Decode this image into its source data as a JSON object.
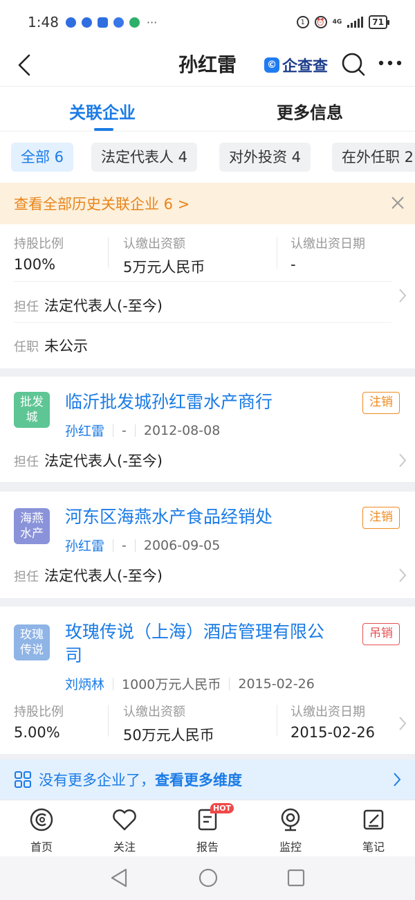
{
  "status_bar": {
    "time": "1:48",
    "more": "···",
    "network": "4G",
    "battery": "71"
  },
  "nav": {
    "title": "孙红雷",
    "brand": "企查查",
    "brand_logo": "©"
  },
  "tabs": [
    {
      "label": "关联企业"
    },
    {
      "label": "更多信息"
    }
  ],
  "filters": [
    {
      "label": "全部 6"
    },
    {
      "label": "法定代表人 4"
    },
    {
      "label": "对外投资 4"
    },
    {
      "label": "在外任职 2"
    }
  ],
  "banner": {
    "text": "查看全部历史关联企业 6 >"
  },
  "card0": {
    "stats": [
      {
        "label": "持股比例",
        "value": "100%"
      },
      {
        "label": "认缴出资额",
        "value": "5万元人民币"
      },
      {
        "label": "认缴出资日期",
        "value": "-"
      }
    ],
    "role_key": "担任",
    "role_value": "法定代表人(-至今)",
    "job_key": "任职",
    "job_value": "未公示"
  },
  "companies": [
    {
      "logo": "批发城",
      "name": "临沂批发城孙红雷水产商行",
      "status": "注销",
      "person": "孙红雷",
      "capital": "-",
      "date": "2012-08-08",
      "role_key": "担任",
      "role_value": "法定代表人(-至今)"
    },
    {
      "logo": "海燕水产",
      "name": "河东区海燕水产食品经销处",
      "status": "注销",
      "person": "孙红雷",
      "capital": "-",
      "date": "2006-09-05",
      "role_key": "担任",
      "role_value": "法定代表人(-至今)"
    },
    {
      "logo": "玫瑰传说",
      "name_line1": "玫瑰传说（上海）酒店管理有限公",
      "name_line2": "司",
      "status": "吊销",
      "person": "刘炳林",
      "capital": "1000万元人民币",
      "date": "2015-02-26",
      "stats": [
        {
          "label": "持股比例",
          "value": "5.00%"
        },
        {
          "label": "认缴出资额",
          "value": "50万元人民币"
        },
        {
          "label": "认缴出资日期",
          "value": "2015-02-26"
        }
      ]
    }
  ],
  "more_bar": {
    "text": "没有更多企业了，",
    "link": "查看更多维度"
  },
  "bottom_nav": [
    {
      "label": "首页"
    },
    {
      "label": "关注"
    },
    {
      "label": "报告",
      "badge": "HOT"
    },
    {
      "label": "监控"
    },
    {
      "label": "笔记"
    }
  ],
  "colors": {
    "accent": "#1a7be6",
    "warning": "#f08a1e",
    "revoked": "#e55050",
    "logo_green": "#5ec594",
    "logo_purple": "#8a93d9",
    "logo_blue": "#8fb4e6"
  }
}
